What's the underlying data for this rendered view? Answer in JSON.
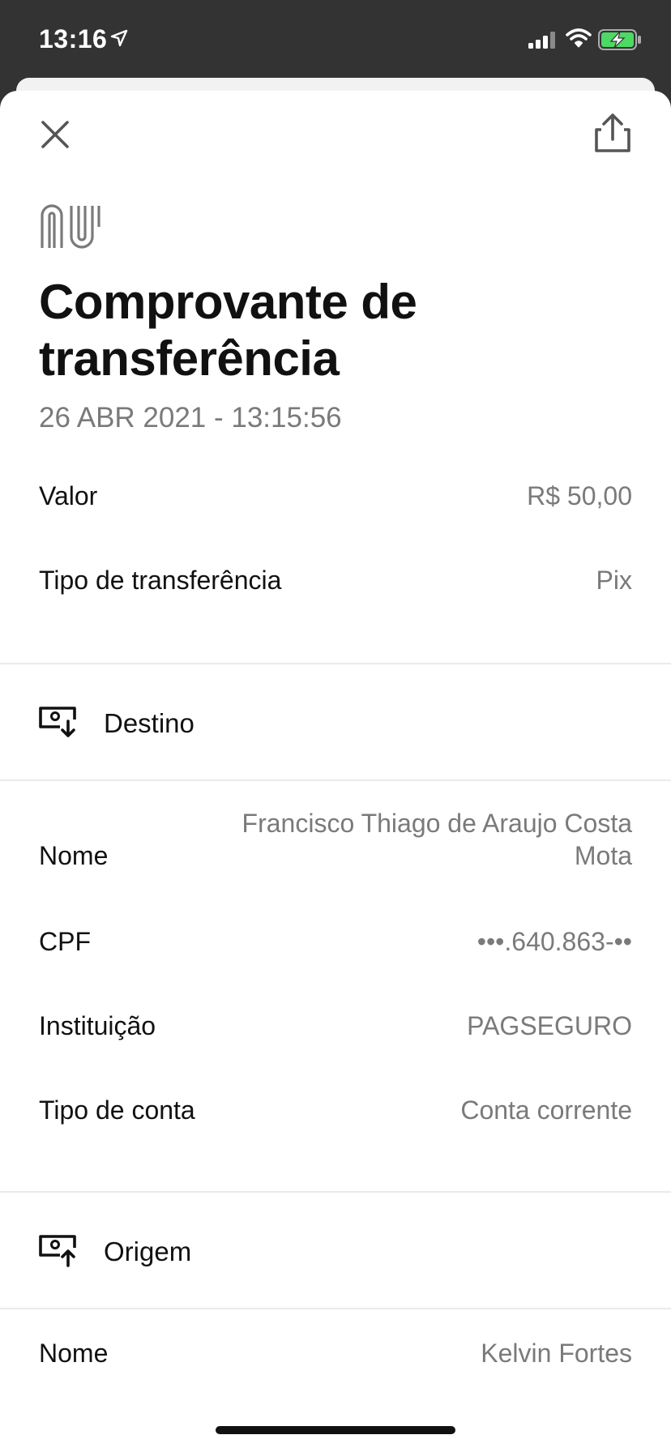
{
  "status_bar": {
    "time": "13:16",
    "icons": [
      "location-arrow-icon",
      "cellular-signal-icon",
      "wifi-icon",
      "battery-charging-icon"
    ]
  },
  "header": {
    "close_icon": "close-icon",
    "share_icon": "share-icon",
    "logo": "nu"
  },
  "receipt": {
    "title": "Comprovante de transferência",
    "datetime": "26 ABR 2021 - 13:15:56",
    "summary": [
      {
        "label": "Valor",
        "value": "R$ 50,00"
      },
      {
        "label": "Tipo de transferência",
        "value": "Pix"
      }
    ],
    "destino": {
      "section_label": "Destino",
      "icon": "receive-money-icon",
      "nome_label": "Nome",
      "nome_line1": "Francisco Thiago de Araujo Costa",
      "nome_line2": "Mota",
      "cpf_label": "CPF",
      "cpf_value": "•••.640.863-••",
      "instituicao_label": "Instituição",
      "instituicao_value": "PAGSEGURO",
      "tipo_conta_label": "Tipo de conta",
      "tipo_conta_value": "Conta corrente"
    },
    "origem": {
      "section_label": "Origem",
      "icon": "send-money-icon",
      "nome_label": "Nome",
      "nome_value": "Kelvin Fortes"
    }
  },
  "colors": {
    "status_bar_bg": "#333333",
    "text_primary": "#111111",
    "text_secondary": "#7a7a7a",
    "divider": "#eaeaea",
    "battery_fill": "#4cd964"
  }
}
